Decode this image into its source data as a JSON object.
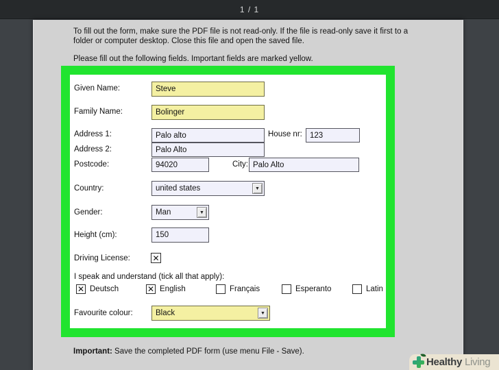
{
  "toolbar": {
    "page_indicator": "1 / 1"
  },
  "document": {
    "intro_line1": "To fill out the form, make sure the PDF file is not read-only. If the file is read-only save it first to a folder or computer desktop. Close this file and open the saved file.",
    "intro_line2": "Please fill out the following fields. Important fields are marked yellow.",
    "footer_bold": "Important:",
    "footer_rest": " Save the completed PDF form (use menu File - Save)."
  },
  "form": {
    "given_name": {
      "label": "Given Name:",
      "value": "Steve"
    },
    "family_name": {
      "label": "Family Name:",
      "value": "Bolinger"
    },
    "address1": {
      "label": "Address 1:",
      "value": "Palo alto"
    },
    "house_nr": {
      "label": "House nr:",
      "value": "123"
    },
    "address2": {
      "label": "Address 2:",
      "value": "Palo Alto"
    },
    "postcode": {
      "label": "Postcode:",
      "value": "94020"
    },
    "city": {
      "label": "City:",
      "value": "Palo Alto"
    },
    "country": {
      "label": "Country:",
      "value": "united states"
    },
    "gender": {
      "label": "Gender:",
      "value": "Man"
    },
    "height": {
      "label": "Height (cm):",
      "value": "150"
    },
    "driving_license": {
      "label": "Driving License:",
      "checked": true
    },
    "languages_prompt": "I speak and understand (tick all that apply):",
    "languages": [
      {
        "label": "Deutsch",
        "checked": true
      },
      {
        "label": "English",
        "checked": true
      },
      {
        "label": "Français",
        "checked": false
      },
      {
        "label": "Esperanto",
        "checked": false
      },
      {
        "label": "Latin",
        "checked": false
      }
    ],
    "favourite_colour": {
      "label": "Favourite colour:",
      "value": "Black"
    }
  },
  "branding": {
    "logo_bold": "Healthy",
    "logo_light": " Living"
  },
  "icons": {
    "dropdown_arrow": "▼"
  },
  "colors": {
    "highlight_green": "#21e42f",
    "field_yellow": "#f4f0a2",
    "field_white": "#f1f1fb",
    "page_gray": "#d2d2d2",
    "chrome_dark": "#3e4246",
    "toolbar_dark": "#26292b",
    "logo_green": "#2fae5e",
    "banner_beige": "#ebe4d2"
  }
}
